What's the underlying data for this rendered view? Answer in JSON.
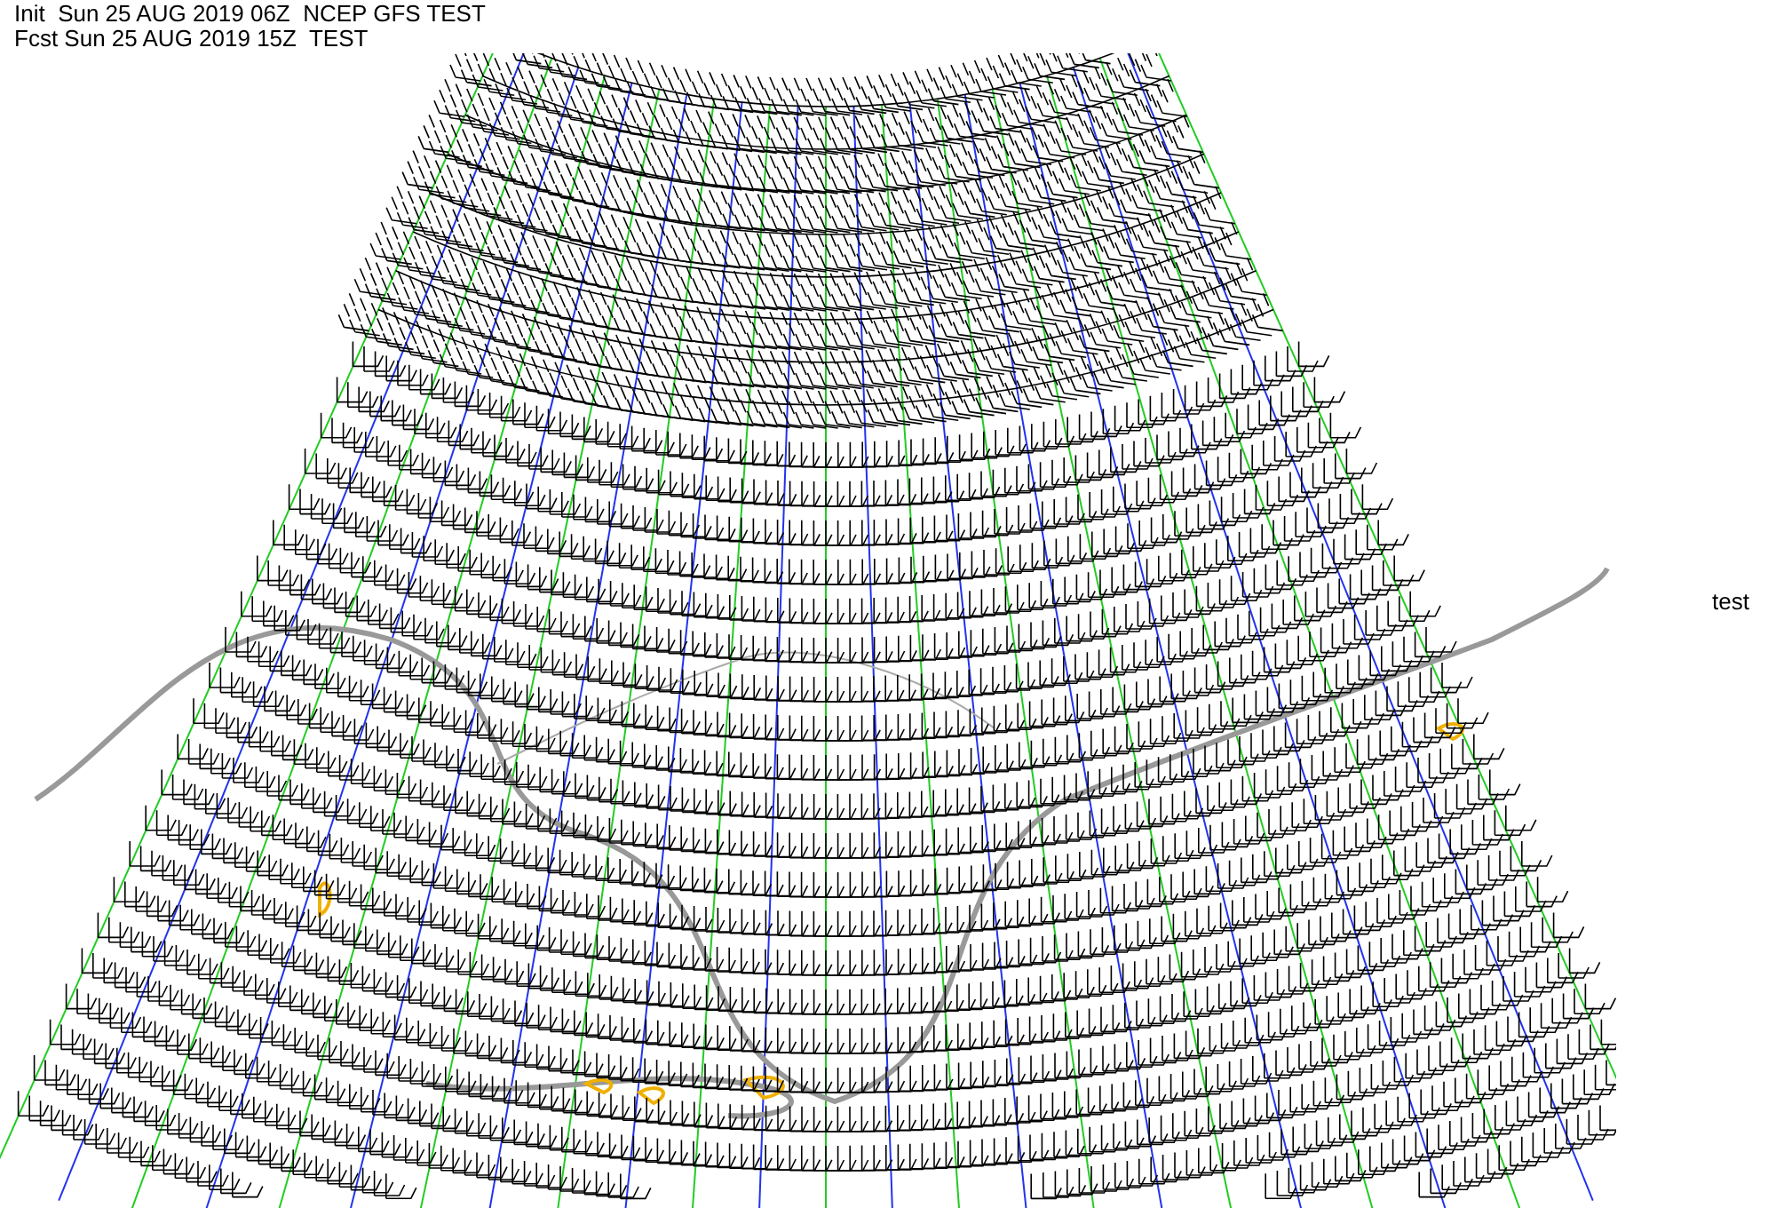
{
  "header": {
    "lines": [
      "Init  Sun 25 AUG 2019 06Z  NCEP GFS TEST",
      "Fcst Sun 25 AUG 2019 15Z  TEST"
    ]
  },
  "side_label": "test"
}
